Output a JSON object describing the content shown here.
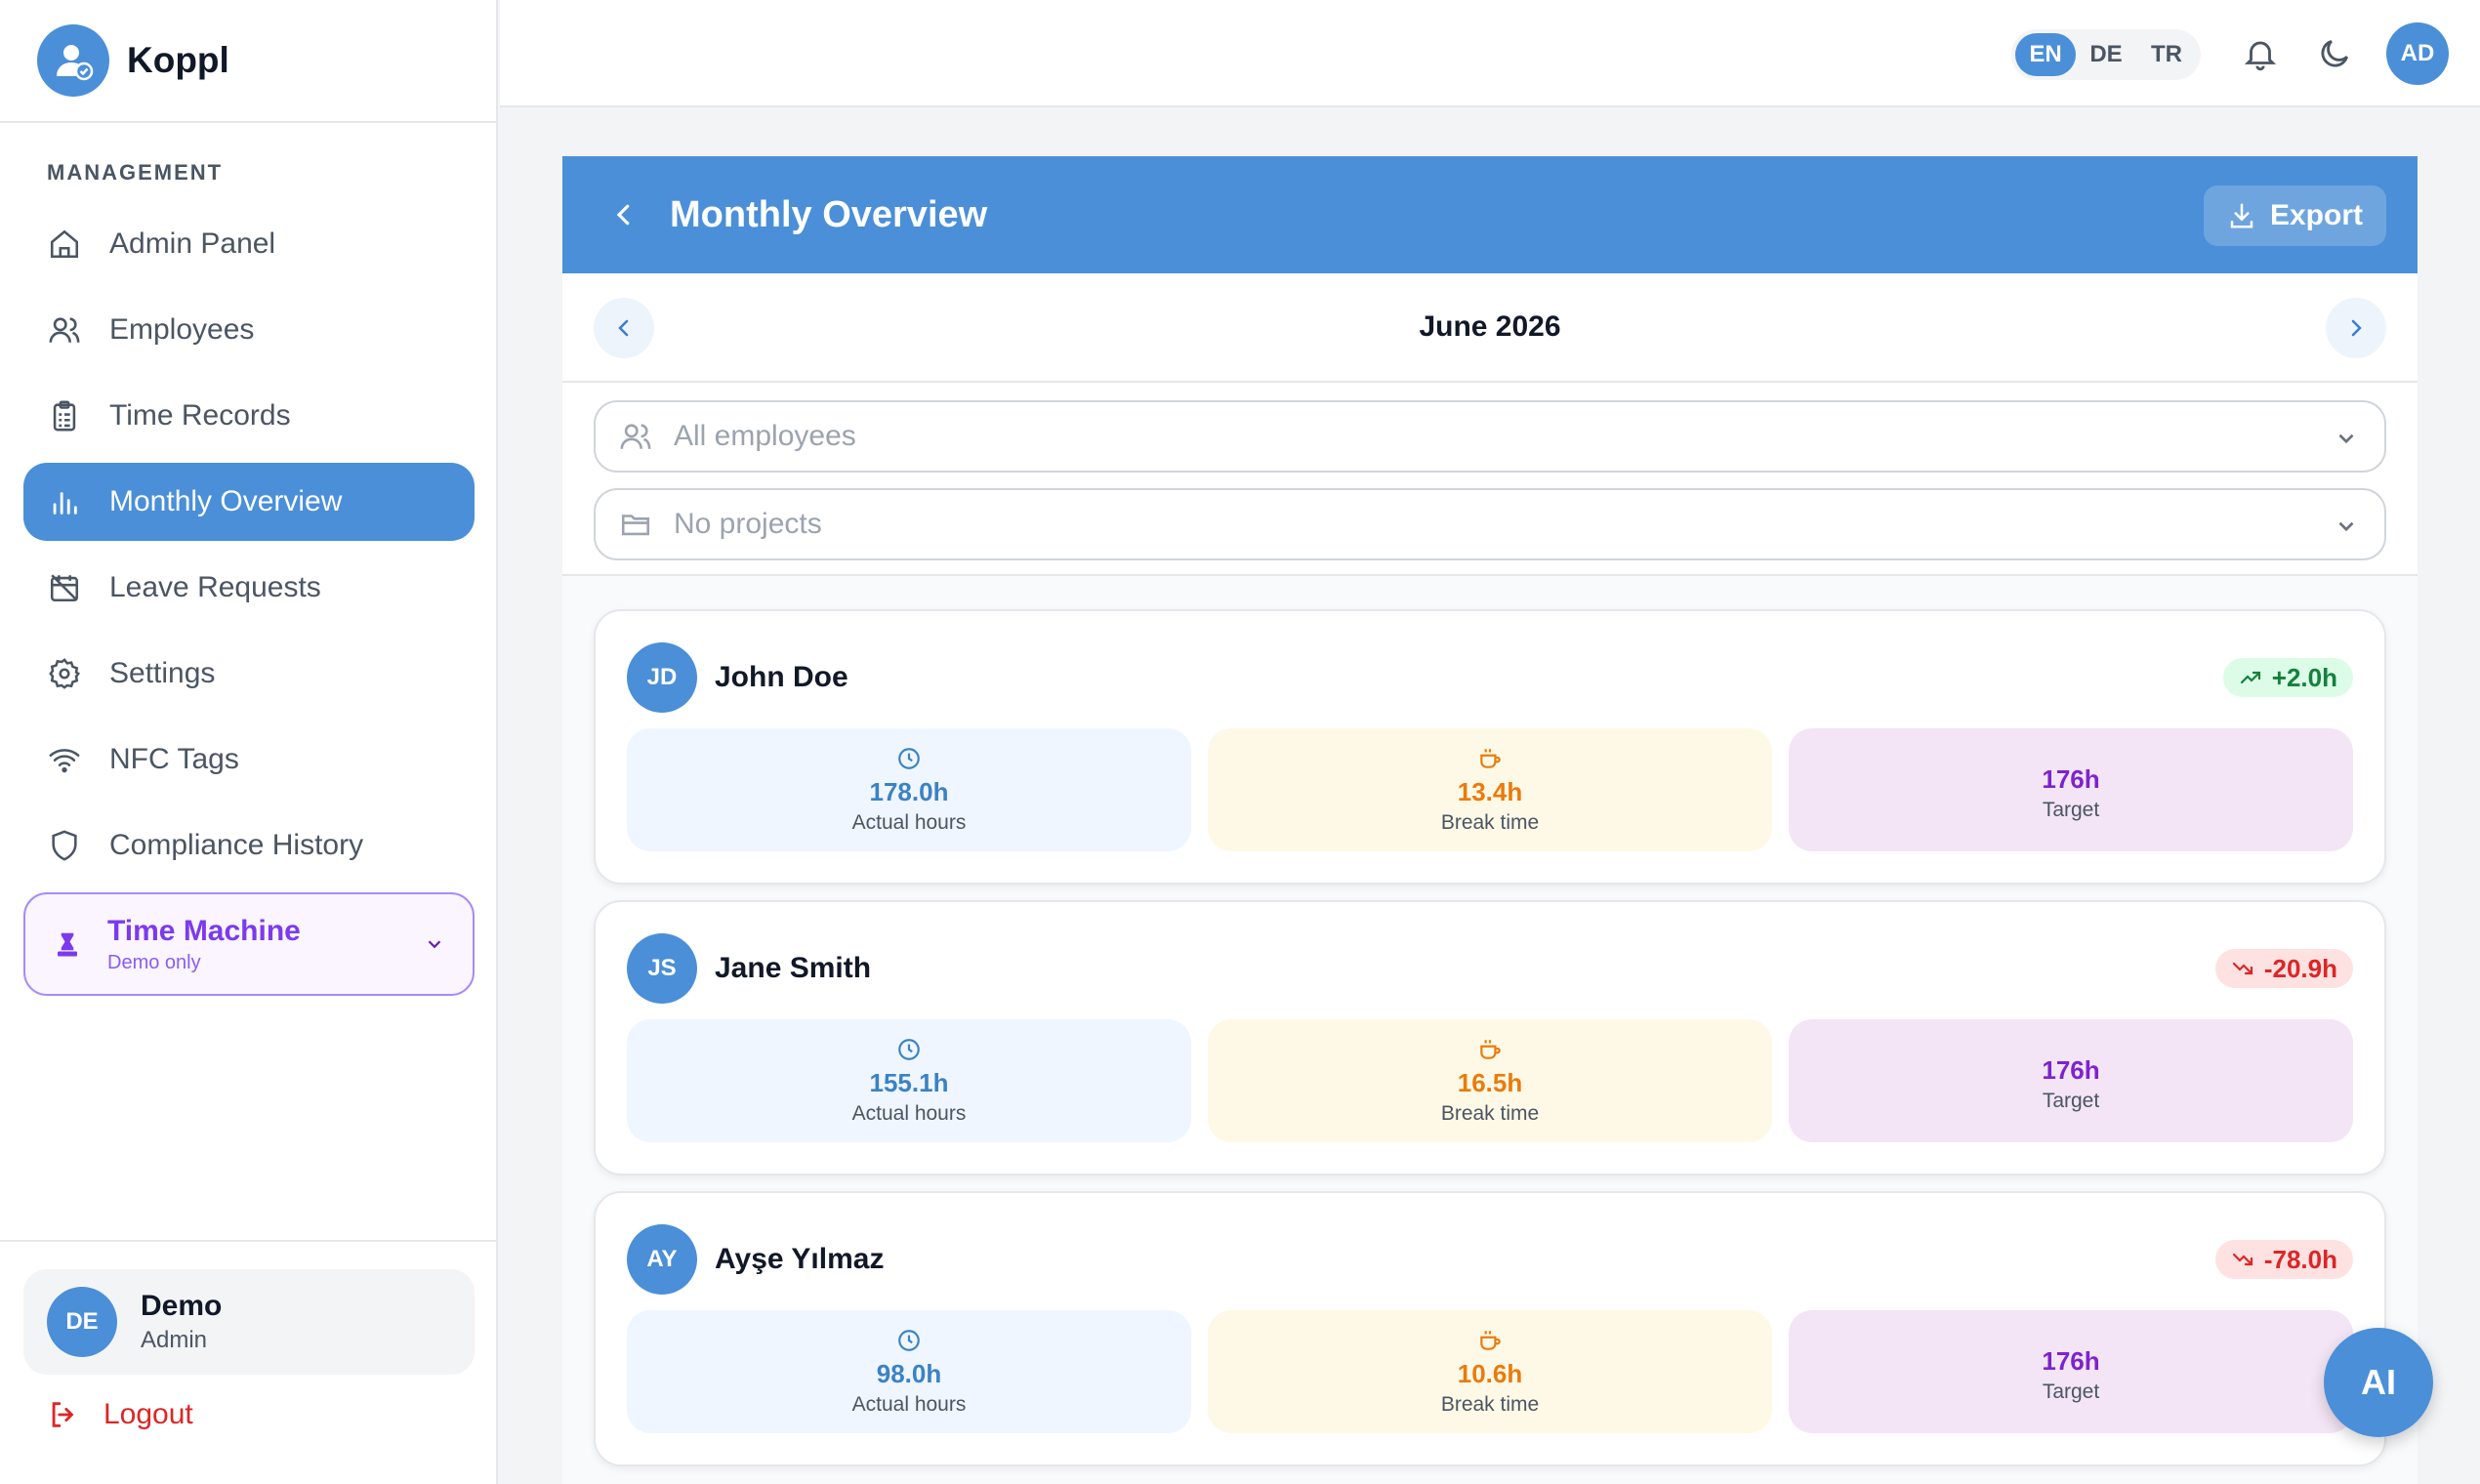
{
  "app": {
    "name": "Koppl"
  },
  "sidebar": {
    "section_label": "MANAGEMENT",
    "items": [
      {
        "label": "Admin Panel",
        "icon": "home-icon"
      },
      {
        "label": "Employees",
        "icon": "users-icon"
      },
      {
        "label": "Time Records",
        "icon": "clipboard-icon"
      },
      {
        "label": "Monthly Overview",
        "icon": "bar-chart-icon",
        "active": true
      },
      {
        "label": "Leave Requests",
        "icon": "calendar-off-icon"
      },
      {
        "label": "Settings",
        "icon": "gear-icon"
      },
      {
        "label": "NFC Tags",
        "icon": "wifi-icon"
      },
      {
        "label": "Compliance History",
        "icon": "shield-icon"
      }
    ],
    "time_machine": {
      "title": "Time Machine",
      "subtitle": "Demo only"
    },
    "user": {
      "initials": "DE",
      "name": "Demo",
      "role": "Admin"
    },
    "logout_label": "Logout"
  },
  "topbar": {
    "languages": [
      "EN",
      "DE",
      "TR"
    ],
    "selected_language": "EN",
    "avatar_initials": "AD"
  },
  "panel": {
    "title": "Monthly Overview",
    "export_label": "Export",
    "month": "June 2026",
    "employee_filter_placeholder": "All employees",
    "project_filter_placeholder": "No projects"
  },
  "employees": [
    {
      "initials": "JD",
      "name": "John Doe",
      "delta": "+2.0h",
      "trend": "up",
      "actual": "178.0h",
      "actual_label": "Actual hours",
      "break": "13.4h",
      "break_label": "Break time",
      "target": "176h",
      "target_label": "Target"
    },
    {
      "initials": "JS",
      "name": "Jane Smith",
      "delta": "-20.9h",
      "trend": "down",
      "actual": "155.1h",
      "actual_label": "Actual hours",
      "break": "16.5h",
      "break_label": "Break time",
      "target": "176h",
      "target_label": "Target"
    },
    {
      "initials": "AY",
      "name": "Ayşe Yılmaz",
      "delta": "-78.0h",
      "trend": "down",
      "actual": "98.0h",
      "actual_label": "Actual hours",
      "break": "10.6h",
      "break_label": "Break time",
      "target": "176h",
      "target_label": "Target"
    }
  ],
  "ai_button_label": "AI",
  "colors": {
    "primary": "#4a8fd8",
    "positive": "#15803d",
    "negative": "#dc2626",
    "break": "#ea7b0c",
    "target": "#7e22ce",
    "time_machine": "#7c3aed"
  }
}
